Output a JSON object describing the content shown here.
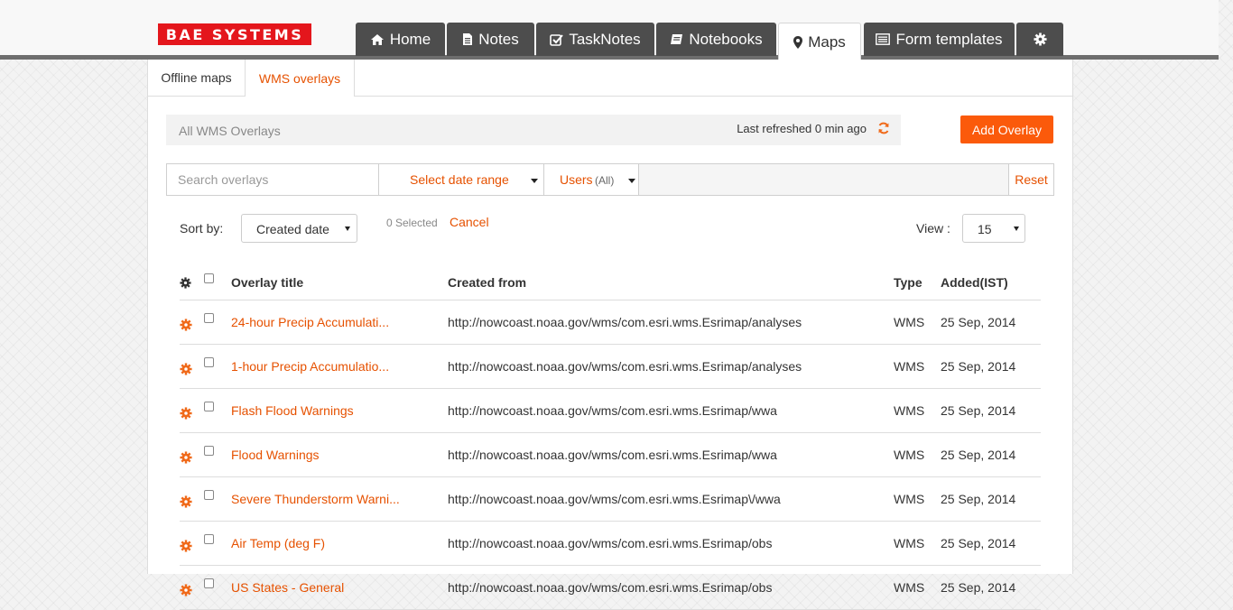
{
  "brand": {
    "logo_text": "BAE SYSTEMS"
  },
  "nav": {
    "tabs": [
      {
        "label": "Home",
        "icon": "home-icon"
      },
      {
        "label": "Notes",
        "icon": "file-icon"
      },
      {
        "label": "TaskNotes",
        "icon": "check-square-icon"
      },
      {
        "label": "Notebooks",
        "icon": "book-icon"
      },
      {
        "label": "Maps",
        "icon": "map-marker-icon",
        "active": true
      },
      {
        "label": "Form templates",
        "icon": "list-icon"
      },
      {
        "label": "",
        "icon": "settings-gear-icon"
      }
    ]
  },
  "subtabs": [
    {
      "label": "Offline maps"
    },
    {
      "label": "WMS overlays",
      "active": true
    }
  ],
  "header": {
    "title": "All WMS Overlays",
    "last_refreshed": "Last refreshed 0 min ago",
    "add_button": "Add Overlay"
  },
  "filters": {
    "search_placeholder": "Search overlays",
    "date_range": "Select date range",
    "users_label": "Users",
    "users_value": "(All)",
    "reset": "Reset"
  },
  "toolbar": {
    "sort_label": "Sort by:",
    "sort_value": "Created date",
    "selected_count": "0 Selected",
    "cancel": "Cancel",
    "view_label": "View :",
    "view_value": "15"
  },
  "table": {
    "columns": [
      "Overlay title",
      "Created from",
      "Type",
      "Added(IST)"
    ],
    "rows": [
      {
        "title": "24-hour Precip Accumulati...",
        "created_from": "http://nowcoast.noaa.gov/wms/com.esri.wms.Esrimap/analyses",
        "type": "WMS",
        "added": "25 Sep, 2014"
      },
      {
        "title": "1-hour Precip Accumulatio...",
        "created_from": "http://nowcoast.noaa.gov/wms/com.esri.wms.Esrimap/analyses",
        "type": "WMS",
        "added": "25 Sep, 2014"
      },
      {
        "title": "Flash Flood Warnings",
        "created_from": "http://nowcoast.noaa.gov/wms/com.esri.wms.Esrimap/wwa",
        "type": "WMS",
        "added": "25 Sep, 2014"
      },
      {
        "title": "Flood Warnings",
        "created_from": "http://nowcoast.noaa.gov/wms/com.esri.wms.Esrimap/wwa",
        "type": "WMS",
        "added": "25 Sep, 2014"
      },
      {
        "title": "Severe Thunderstorm Warni...",
        "created_from": "http://nowcoast.noaa.gov/wms/com.esri.wms.Esrimap\\/wwa",
        "type": "WMS",
        "added": "25 Sep, 2014"
      },
      {
        "title": "Air Temp (deg F)",
        "created_from": "http://nowcoast.noaa.gov/wms/com.esri.wms.Esrimap/obs",
        "type": "WMS",
        "added": "25 Sep, 2014"
      },
      {
        "title": "US States - General",
        "created_from": "http://nowcoast.noaa.gov/wms/com.esri.wms.Esrimap/obs",
        "type": "WMS",
        "added": "25 Sep, 2014"
      }
    ]
  },
  "colors": {
    "accent": "#e65100",
    "button": "#fb5a0b",
    "tab_bg": "#4d4d4d",
    "logo_red": "#e4161c"
  }
}
